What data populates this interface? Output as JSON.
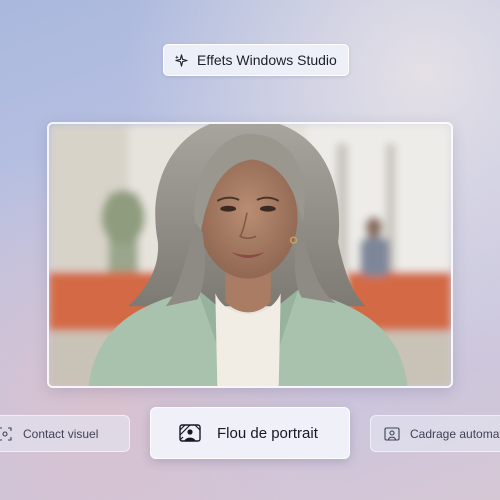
{
  "header": {
    "title": "Effets Windows Studio",
    "icon": "sparkle-icon"
  },
  "preview": {
    "description_icon": "webcam-preview"
  },
  "effects": [
    {
      "label": "Contact visuel",
      "icon": "eye-contact-icon",
      "active": false
    },
    {
      "label": "Flou de portrait",
      "icon": "portrait-blur-icon",
      "active": true
    },
    {
      "label": "Cadrage automatique",
      "icon": "auto-framing-icon",
      "active": false
    }
  ],
  "colors": {
    "accent_text": "#161923",
    "background": "#b9c1e2",
    "blazer": "#a9c2ad"
  }
}
